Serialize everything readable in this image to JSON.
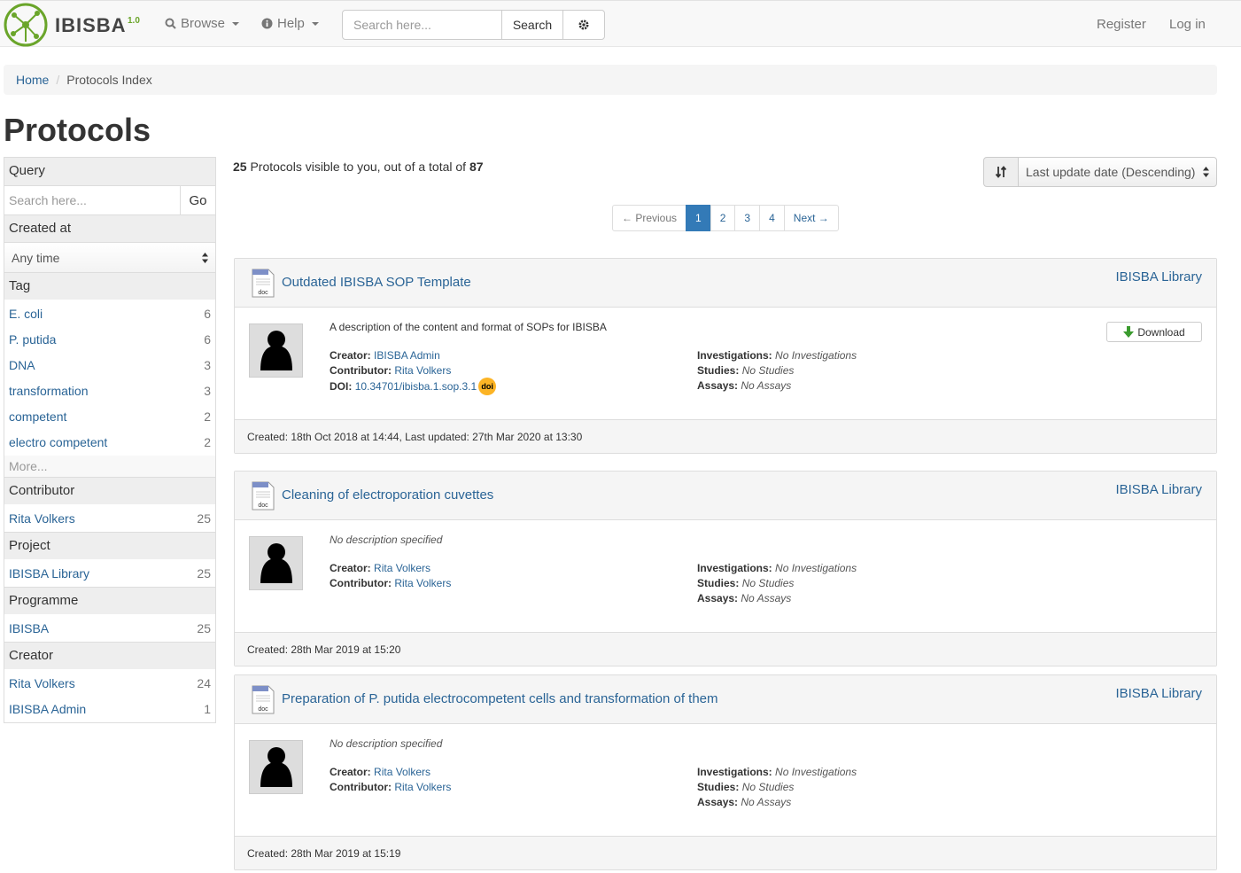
{
  "navbar": {
    "logo_text": "IBISBA",
    "logo_version": "1.0",
    "browse_label": "Browse",
    "help_label": "Help",
    "search_placeholder": "Search here...",
    "search_button": "Search",
    "register_label": "Register",
    "login_label": "Log in"
  },
  "breadcrumb": {
    "home": "Home",
    "current": "Protocols Index"
  },
  "page_title": "Protocols",
  "sidebar": {
    "query_heading": "Query",
    "query_placeholder": "Search here...",
    "query_go": "Go",
    "created_heading": "Created at",
    "created_value": "Any time",
    "tag_heading": "Tag",
    "tags": [
      {
        "label": "E. coli",
        "count": "6"
      },
      {
        "label": "P. putida",
        "count": "6"
      },
      {
        "label": "DNA",
        "count": "3"
      },
      {
        "label": "transformation",
        "count": "3"
      },
      {
        "label": "competent",
        "count": "2"
      },
      {
        "label": "electro competent",
        "count": "2"
      }
    ],
    "more_label": "More...",
    "contributor_heading": "Contributor",
    "contributors": [
      {
        "label": "Rita Volkers",
        "count": "25"
      }
    ],
    "project_heading": "Project",
    "projects": [
      {
        "label": "IBISBA Library",
        "count": "25"
      }
    ],
    "programme_heading": "Programme",
    "programmes": [
      {
        "label": "IBISBA",
        "count": "25"
      }
    ],
    "creator_heading": "Creator",
    "creators": [
      {
        "label": "Rita Volkers",
        "count": "24"
      },
      {
        "label": "IBISBA Admin",
        "count": "1"
      }
    ]
  },
  "results": {
    "visible": "25",
    "text_middle": " Protocols visible to you, out of a total of ",
    "total": "87"
  },
  "sort": {
    "value": "Last update date (Descending)"
  },
  "pagination": {
    "previous": "← Previous",
    "pages": [
      "1",
      "2",
      "3",
      "4"
    ],
    "next": "Next →",
    "active": "1"
  },
  "labels": {
    "creator": "Creator:",
    "contributor": "Contributor:",
    "doi": "DOI:",
    "investigations": "Investigations:",
    "studies": "Studies:",
    "assays": "Assays:",
    "no_investigations": "No Investigations",
    "no_studies": "No Studies",
    "no_assays": "No Assays",
    "download": "Download",
    "doi_badge": "doi"
  },
  "items": [
    {
      "title": "Outdated IBISBA SOP Template",
      "project": "IBISBA Library",
      "description": "A description of the content and format of SOPs for IBISBA",
      "creator": "IBISBA Admin",
      "contributor": "Rita Volkers",
      "doi": "10.34701/ibisba.1.sop.3.1",
      "footer": "Created: 18th Oct 2018 at 14:44, Last updated: 27th Mar 2020 at 13:30"
    },
    {
      "title": "Cleaning of electroporation cuvettes",
      "project": "IBISBA Library",
      "description": "No description specified",
      "creator": "Rita Volkers",
      "contributor": "Rita Volkers",
      "footer": "Created: 28th Mar 2019 at 15:20"
    },
    {
      "title": "Preparation of P. putida electrocompetent cells and transformation of them",
      "project": "IBISBA Library",
      "description": "No description specified",
      "creator": "Rita Volkers",
      "contributor": "Rita Volkers",
      "footer": "Created: 28th Mar 2019 at 15:19"
    }
  ],
  "colors": {
    "link": "#2a6496",
    "active_page": "#337ab7",
    "logo_green": "#6aa52a",
    "doi_badge": "#fcb425"
  }
}
